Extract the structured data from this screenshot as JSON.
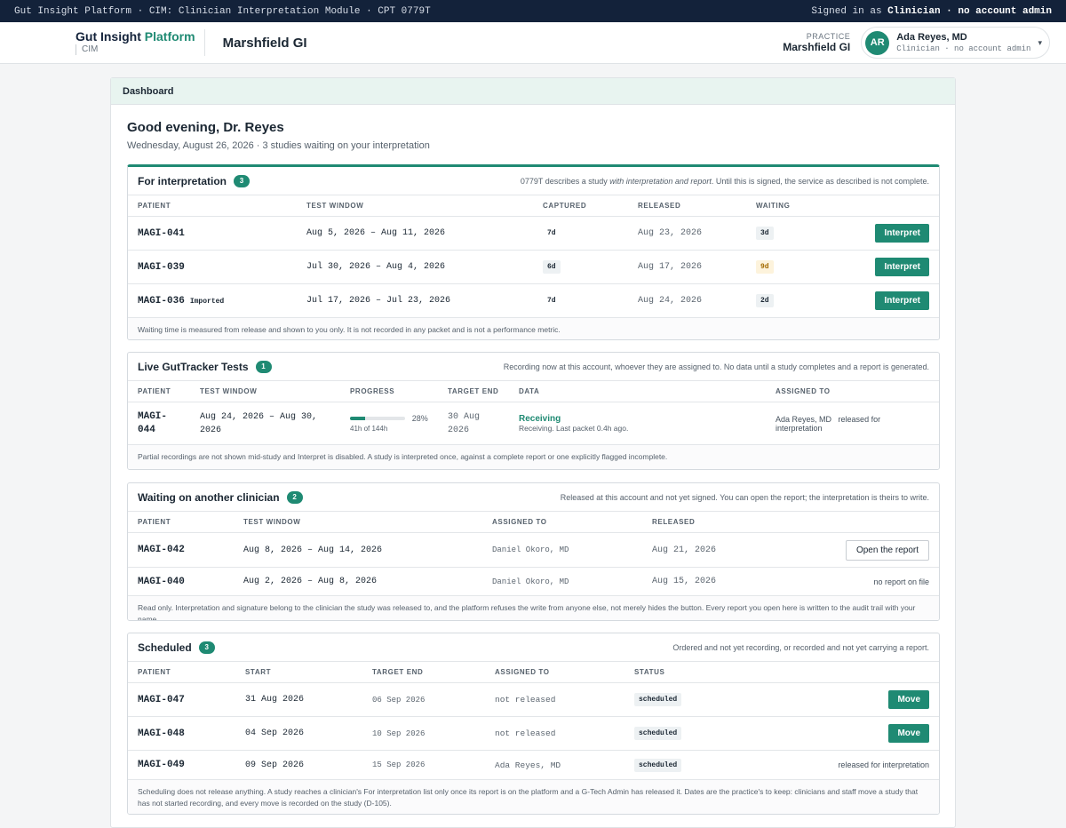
{
  "topbar": {
    "left": "Gut Insight Platform · CIM: Clinician Interpretation Module · CPT 0779T",
    "signed_prefix": "Signed in as",
    "signed_role": "Clinician · no account admin"
  },
  "header": {
    "brand_a": "Gut Insight",
    "brand_b": "Platform",
    "brand_sub": "CIM",
    "practice_title": "Marshfield GI",
    "practice_label": "PRACTICE",
    "practice_value": "Marshfield GI",
    "avatar": "AR",
    "user_name": "Ada Reyes, MD",
    "user_role": "Clinician · no account admin"
  },
  "dashboard": {
    "title": "Dashboard",
    "greeting": "Good evening, Dr. Reyes",
    "subgreeting": "Wednesday, August 26, 2026 · 3 studies waiting on your interpretation"
  },
  "interp": {
    "title": "For interpretation",
    "count": "3",
    "note_a": "0779T describes a study ",
    "note_b": "with interpretation and report",
    "note_c": ". Until this is signed, the service as described is not complete.",
    "cols": [
      "PATIENT",
      "TEST WINDOW",
      "CAPTURED",
      "RELEASED",
      "WAITING"
    ],
    "rows": [
      {
        "patient": "MAGI-041",
        "tag": "",
        "window": "Aug 5, 2026 – Aug 11, 2026",
        "captured": "7d",
        "released": "Aug 23, 2026",
        "waiting": "3d",
        "action": "Interpret"
      },
      {
        "patient": "MAGI-039",
        "tag": "",
        "window": "Jul 30, 2026 – Aug 4, 2026",
        "captured": "6d",
        "released": "Aug 17, 2026",
        "waiting": "9d",
        "action": "Interpret"
      },
      {
        "patient": "MAGI-036",
        "tag": "Imported",
        "window": "Jul 17, 2026 – Jul 23, 2026",
        "captured": "7d",
        "released": "Aug 24, 2026",
        "waiting": "2d",
        "action": "Interpret"
      }
    ],
    "footer": "Waiting time is measured from release and shown to you only. It is not recorded in any packet and is not a performance metric."
  },
  "live": {
    "title": "Live GutTracker Tests",
    "count": "1",
    "note": "Recording now at this account, whoever they are assigned to. No data until a study completes and a report is generated.",
    "cols": [
      "PATIENT",
      "TEST WINDOW",
      "PROGRESS",
      "TARGET END",
      "DATA",
      "ASSIGNED TO"
    ],
    "row": {
      "patient_a": "MAGI-",
      "patient_b": "044",
      "window_a": "Aug 24, 2026 – Aug 30,",
      "window_b": "2026",
      "progress_pct": 28,
      "progress_label": "28%",
      "progress_sub": "41h of 144h",
      "target_a": "30 Aug",
      "target_b": "2026",
      "data_status": "Receiving",
      "data_sub": "Receiving. Last packet 0.4h ago.",
      "assigned": "Ada Reyes, MD",
      "assigned_note": "released for interpretation"
    },
    "footer": "Partial recordings are not shown mid-study and Interpret is disabled. A study is interpreted once, against a complete report or one explicitly flagged incomplete."
  },
  "waiting": {
    "title": "Waiting on another clinician",
    "count": "2",
    "note": "Released at this account and not yet signed. You can open the report; the interpretation is theirs to write.",
    "cols": [
      "PATIENT",
      "TEST WINDOW",
      "ASSIGNED TO",
      "RELEASED"
    ],
    "rows": [
      {
        "patient": "MAGI-042",
        "window": "Aug 8, 2026 – Aug 14, 2026",
        "assigned": "Daniel Okoro, MD",
        "released": "Aug 21, 2026",
        "action": "Open the report"
      },
      {
        "patient": "MAGI-040",
        "window": "Aug 2, 2026 – Aug 8, 2026",
        "assigned": "Daniel Okoro, MD",
        "released": "Aug 15, 2026",
        "action": "no report on file"
      }
    ],
    "footer": "Read only. Interpretation and signature belong to the clinician the study was released to, and the platform refuses the write from anyone else, not merely hides the button. Every report you open here is written to the audit trail with your name."
  },
  "scheduled": {
    "title": "Scheduled",
    "count": "3",
    "note": "Ordered and not yet recording, or recorded and not yet carrying a report.",
    "cols": [
      "PATIENT",
      "START",
      "TARGET END",
      "ASSIGNED TO",
      "STATUS"
    ],
    "rows": [
      {
        "patient": "MAGI-047",
        "start": "31 Aug 2026",
        "target": "06 Sep 2026",
        "assigned": "not released",
        "status": "scheduled",
        "action": "Move"
      },
      {
        "patient": "MAGI-048",
        "start": "04 Sep 2026",
        "target": "10 Sep 2026",
        "assigned": "not released",
        "status": "scheduled",
        "action": "Move"
      },
      {
        "patient": "MAGI-049",
        "start": "09 Sep 2026",
        "target": "15 Sep 2026",
        "assigned": "Ada Reyes, MD",
        "status": "scheduled",
        "action": "released for interpretation"
      }
    ],
    "footer": "Scheduling does not release anything. A study reaches a clinician's For interpretation list only once its report is on the platform and a G-Tech Admin has released it. Dates are the practice's to keep: clinicians and staff move a study that has not started recording, and every move is recorded on the study (D-105)."
  }
}
